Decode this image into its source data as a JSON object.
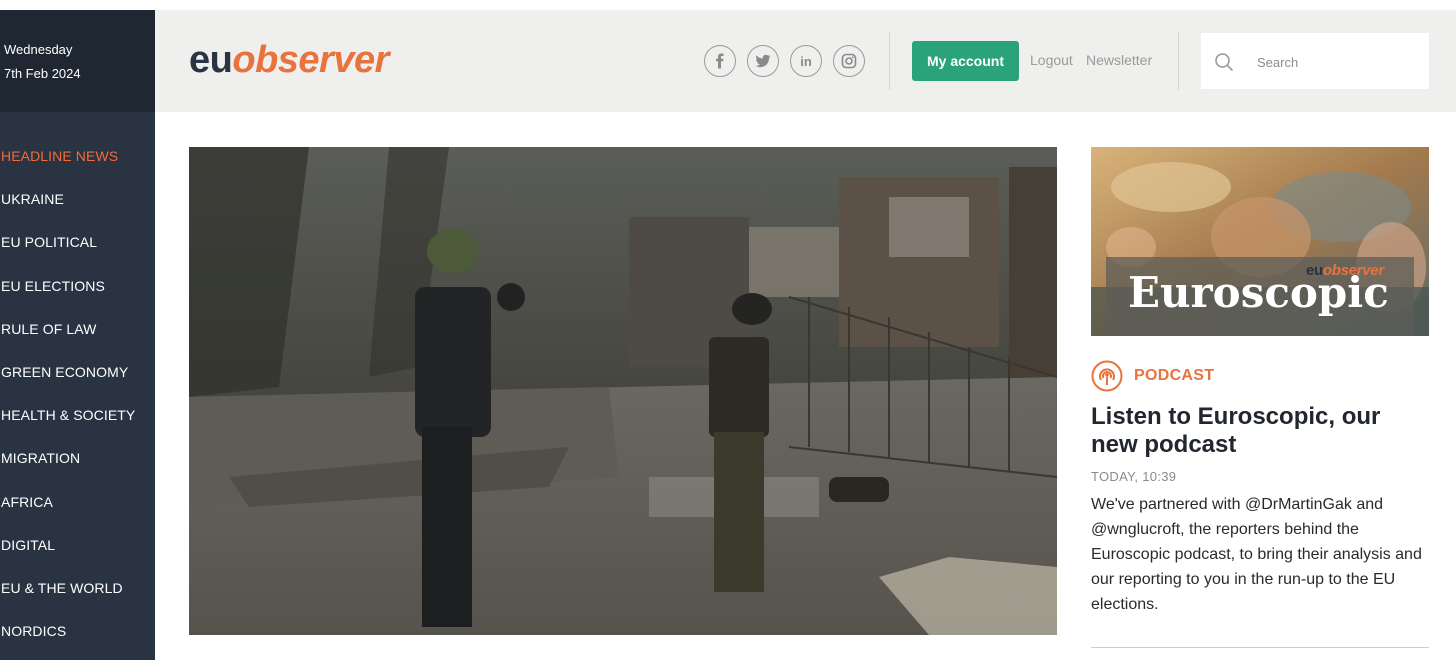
{
  "sidebar": {
    "date_weekday": "Wednesday",
    "date_full": "7th Feb 2024",
    "nav": [
      {
        "label": "HEADLINE NEWS",
        "active": true
      },
      {
        "label": "UKRAINE"
      },
      {
        "label": "EU POLITICAL"
      },
      {
        "label": "EU ELECTIONS"
      },
      {
        "label": "RULE OF LAW"
      },
      {
        "label": "GREEN ECONOMY"
      },
      {
        "label": "HEALTH & SOCIETY"
      },
      {
        "label": "MIGRATION"
      },
      {
        "label": "AFRICA"
      },
      {
        "label": "DIGITAL"
      },
      {
        "label": "EU & THE WORLD"
      },
      {
        "label": "NORDICS"
      }
    ]
  },
  "header": {
    "logo_eu": "eu",
    "logo_observer": "observer",
    "socials": [
      "facebook-icon",
      "twitter-icon",
      "linkedin-icon",
      "instagram-icon"
    ],
    "linkedin_text": "in",
    "my_account_label": "My account",
    "logout_label": "Logout",
    "newsletter_label": "Newsletter",
    "search_placeholder": "Search"
  },
  "promo": {
    "title": "Euroscopic",
    "brand_eu": "eu",
    "brand_observer": "observer"
  },
  "article": {
    "category": "PODCAST",
    "headline": "Listen to Euroscopic, our new podcast",
    "timestamp": "TODAY, 10:39",
    "summary": "We've partnered with @DrMartinGak and @wnglucroft, the reporters behind the Euroscopic podcast, to bring their analysis and our reporting to you in the run-up to the EU elections."
  },
  "colors": {
    "sidebar_bg": "#2a3342",
    "accent_orange": "#e8733d",
    "account_green": "#2aa27a",
    "header_bg": "#efefed"
  }
}
